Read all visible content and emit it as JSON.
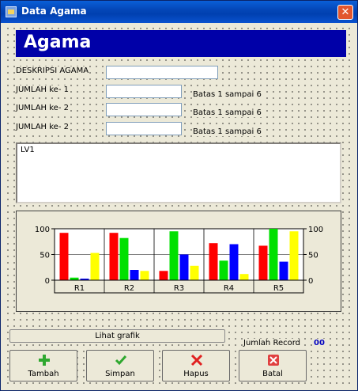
{
  "window": {
    "title": "Data Agama",
    "close_glyph": "✕"
  },
  "header": {
    "title": "Agama"
  },
  "form": {
    "fields": [
      {
        "label": "DESKRIPSI AGAMA",
        "value": "",
        "hint": ""
      },
      {
        "label": "JUMLAH ke- 1",
        "value": "",
        "hint": "Batas 1 sampai 6"
      },
      {
        "label": "JUMLAH ke- 2",
        "value": "",
        "hint": "Batas 1 sampai 6"
      },
      {
        "label": "JUMLAH ke- 2",
        "value": "",
        "hint": "Batas 1 sampai 6"
      }
    ]
  },
  "listview": {
    "text": "LV1"
  },
  "chart_data": {
    "type": "bar",
    "categories": [
      "R1",
      "R2",
      "R3",
      "R4",
      "R5"
    ],
    "series": [
      {
        "values": [
          92,
          92,
          18,
          72,
          67
        ],
        "color": "#ff0000"
      },
      {
        "values": [
          5,
          82,
          95,
          38,
          100
        ],
        "color": "#00e000"
      },
      {
        "values": [
          3,
          20,
          50,
          70,
          36
        ],
        "color": "#0000ff"
      },
      {
        "values": [
          53,
          18,
          28,
          12,
          95
        ],
        "color": "#ffff00"
      }
    ],
    "ylim": [
      0,
      100
    ],
    "yticks": [
      0,
      50,
      100
    ],
    "grid": true,
    "right_axis": true
  },
  "buttons": {
    "lihat_grafik": "Lihat grafik",
    "tambah": "Tambah",
    "simpan": "Simpan",
    "hapus": "Hapus",
    "batal": "Batal"
  },
  "record": {
    "label": "Jumlah Record",
    "value": "00"
  },
  "icons": {
    "tambah": "plus-icon",
    "simpan": "checkmark-icon",
    "hapus": "x-icon",
    "batal": "cancel-icon"
  }
}
